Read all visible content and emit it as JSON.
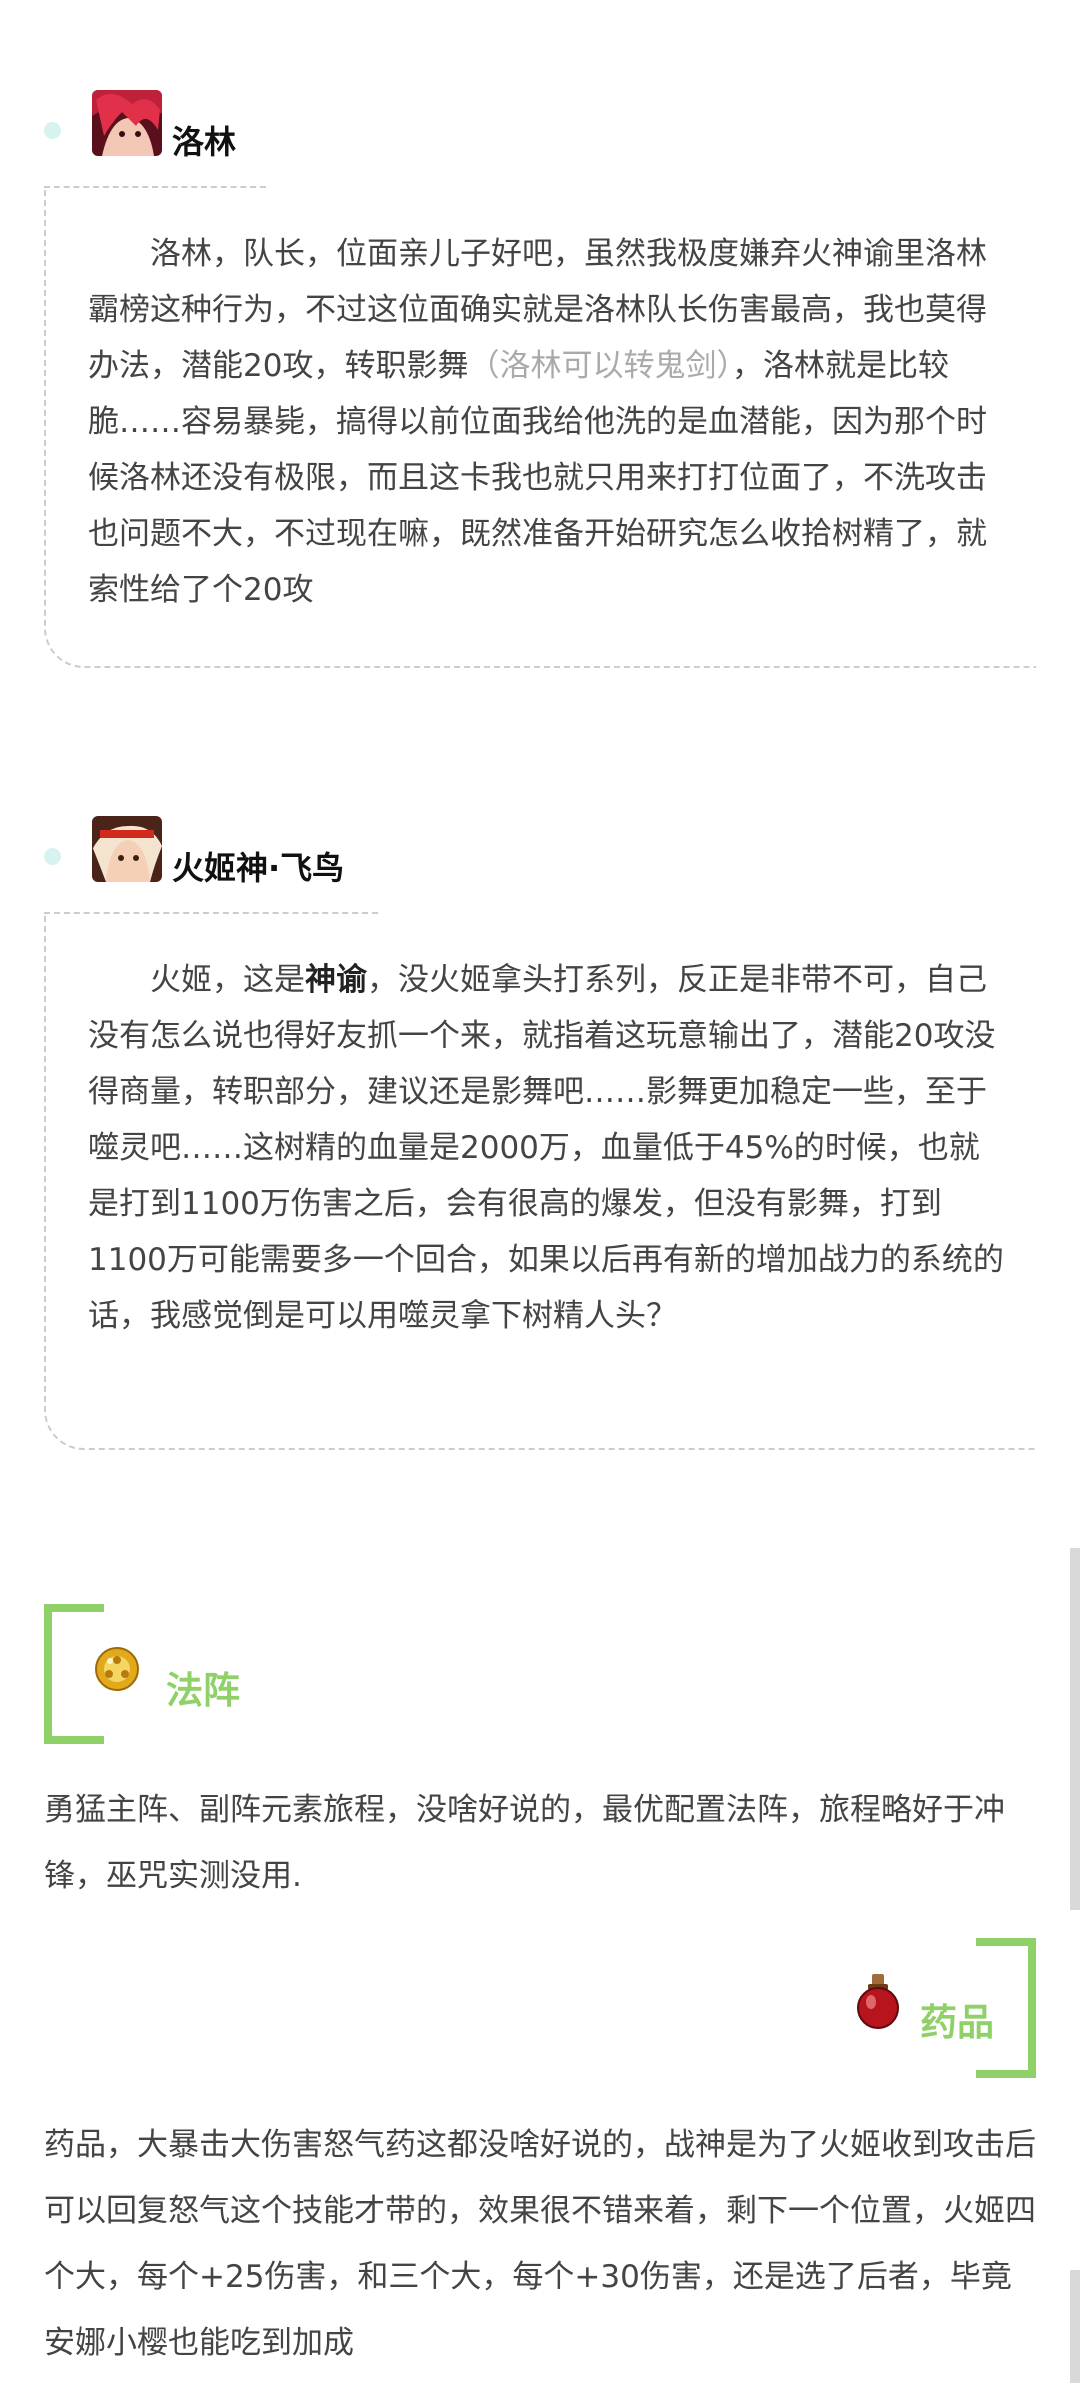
{
  "cards": [
    {
      "name": "洛林",
      "avatar_icon": "hero-lorin-avatar-icon",
      "text_before": "洛林，队长，位面亲儿子好吧，虽然我极度嫌弃火神谕里洛林霸榜这种行为，不过这位面确实就是洛林队长伤害最高，我也莫得办法，潜能20攻，转职影舞",
      "text_muted": "（洛林可以转鬼剑）",
      "text_after": "，洛林就是比较脆……容易暴毙，搞得以前位面我给他洗的是血潜能，因为那个时候洛林还没有极限，而且这卡我也就只用来打打位面了，不洗攻击也问题不大，不过现在嘛，既然准备开始研究怎么收拾树精了，就索性给了个20攻"
    },
    {
      "name": "火姬神·飞鸟",
      "avatar_icon": "hero-asuka-avatar-icon",
      "text_before": "火姬，这是",
      "text_bold": "神谕",
      "text_after": "，没火姬拿头打系列，反正是非带不可，自己没有怎么说也得好友抓一个来，就指着这玩意输出了，潜能20攻没得商量，转职部分，建议还是影舞吧……影舞更加稳定一些，至于噬灵吧……这树精的血量是2000万，血量低于45%的时候，也就是打到1100万伤害之后，会有很高的爆发，但没有影舞，打到1100万可能需要多一个回合，如果以后再有新的增加战力的系统的话，我感觉倒是可以用噬灵拿下树精人头？"
    }
  ],
  "sections": [
    {
      "title": "法阵",
      "icon": "formation-orb-icon",
      "text": "勇猛主阵、副阵元素旅程，没啥好说的，最优配置法阵，旅程略好于冲锋，巫咒实测没用."
    },
    {
      "title": "药品",
      "icon": "potion-flask-icon",
      "text": "药品，大暴击大伤害怒气药这都没啥好说的，战神是为了火姬收到攻击后可以回复怒气这个技能才带的，效果很不错来着，剩下一个位置，火姬四个大，每个+25伤害，和三个大，每个+30伤害，还是选了后者，毕竟安娜小樱也能吃到加成"
    }
  ],
  "colors": {
    "accent_green": "#8fd068",
    "dot_teal": "#d6f3ef",
    "dash_gray": "#cccccc",
    "muted_text": "#aaaaaa"
  }
}
